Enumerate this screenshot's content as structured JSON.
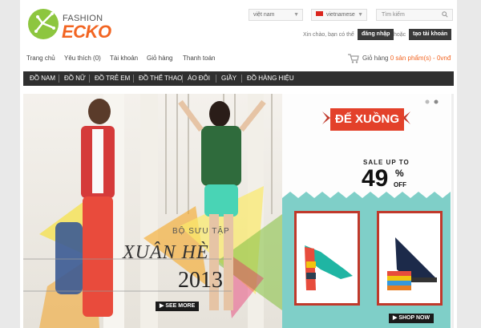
{
  "logo": {
    "line1": "FASHION",
    "line2": "ECKO"
  },
  "header": {
    "country_select": "việt nam",
    "language_select": "vietnamese",
    "search_placeholder": "Tìm kiếm",
    "greeting": "Xin chào, bạn có thể",
    "login_label": "đăng nhập",
    "or_text": "hoặc",
    "register_label": "tạo tài khoản"
  },
  "topnav": [
    {
      "label": "Trang chủ"
    },
    {
      "label": "Yêu thích (0)"
    },
    {
      "label": "Tài khoản"
    },
    {
      "label": "Giỏ hàng"
    },
    {
      "label": "Thanh toán"
    }
  ],
  "cart": {
    "label": "Giỏ hàng",
    "value": "0 sản phẩm(s) - 0vnđ"
  },
  "categories": [
    {
      "label": "ĐỒ NAM"
    },
    {
      "label": "ĐỒ NỮ"
    },
    {
      "label": "ĐỒ TRẺ EM"
    },
    {
      "label": "ĐỒ THỂ THAO"
    },
    {
      "label": "ÁO ĐÔI"
    },
    {
      "label": "GIẦY"
    },
    {
      "label": "ĐỒ HÀNG HIỆU"
    }
  ],
  "banner": {
    "collection_line1": "BỘ SƯU TẬP",
    "collection_line2": "XUÂN HÈ",
    "collection_line3": "2013",
    "cta": "SEE MORE"
  },
  "promo": {
    "title": "ĐẾ XUỒNG",
    "sale_up_to": "SALE UP TO",
    "sale_number": "49",
    "sale_pct": "%",
    "sale_off": "OFF",
    "cta": "SHOP NOW"
  },
  "colors": {
    "brand_orange": "#f26522",
    "brand_green": "#8dc63f",
    "nav_dark": "#2f2f2f",
    "promo_red": "#e3412a",
    "promo_teal": "#7fcfc8"
  }
}
